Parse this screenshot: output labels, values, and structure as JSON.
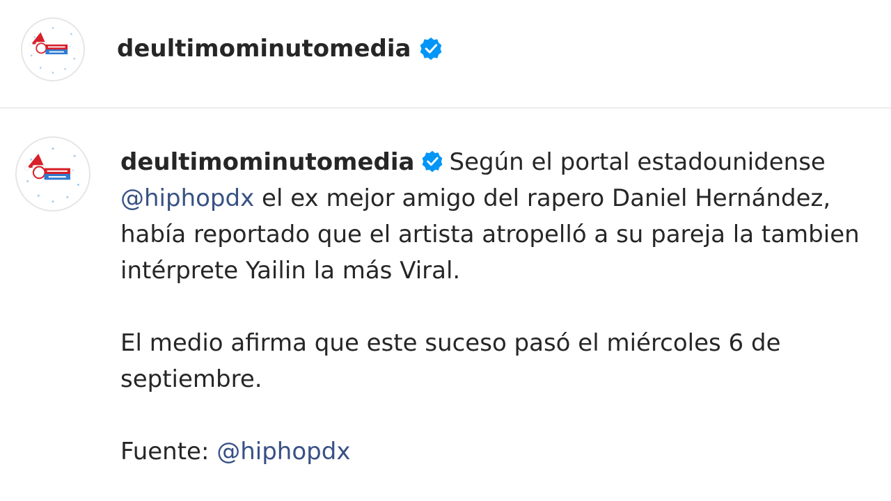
{
  "post": {
    "username": "deultimominutomedia",
    "verified_icon": "verified-badge-icon",
    "avatar_icon": "deultimominuto-logo-icon",
    "accent_color": "#0095f6",
    "mention_color": "#385185"
  },
  "caption": {
    "username": "deultimominutomedia",
    "p1_text_a": "Según el portal estadounidense",
    "p1_mention": "@hiphopdx",
    "p1_text_b": "el ex mejor amigo del rapero Daniel Hernández, había reportado que el artista atropelló a su pareja la tambien intérprete Yailin la más Viral.",
    "p2_text": "El medio afirma que este suceso pasó el miércoles 6 de septiembre.",
    "p3_label": "Fuente:",
    "p3_mention": "@hiphopdx"
  }
}
